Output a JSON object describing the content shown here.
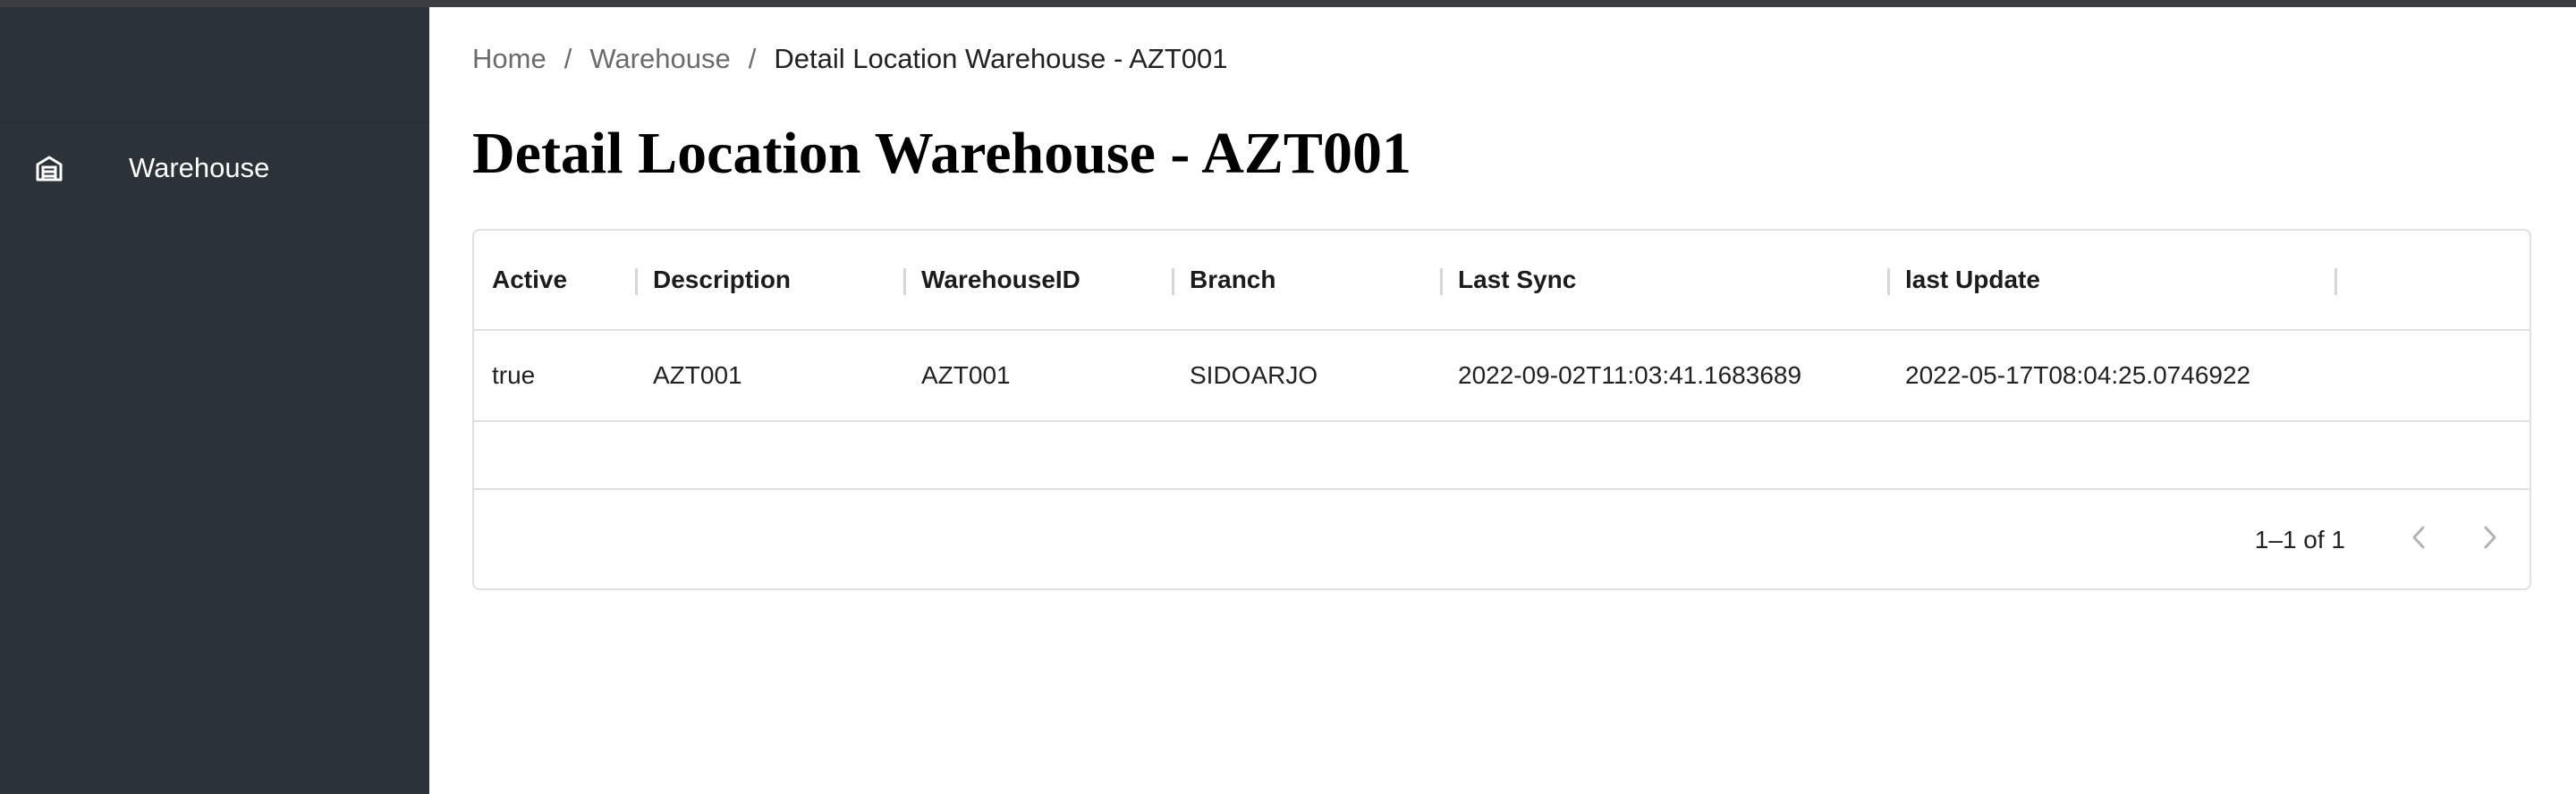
{
  "sidebar": {
    "items": [
      {
        "label": "Warehouse",
        "icon": "warehouse-icon"
      }
    ]
  },
  "breadcrumb": {
    "home": "Home",
    "warehouse": "Warehouse",
    "current": "Detail Location Warehouse - AZT001",
    "separator": "/"
  },
  "page": {
    "title": "Detail Location Warehouse - AZT001"
  },
  "table": {
    "columns": [
      "Active",
      "Description",
      "WarehouseID",
      "Branch",
      "Last Sync",
      "last Update"
    ],
    "rows": [
      [
        "true",
        "AZT001",
        "AZT001",
        "SIDOARJO",
        "2022-09-02T11:03:41.1683689",
        "2022-05-17T08:04:25.0746922"
      ]
    ]
  },
  "pagination": {
    "text": "1–1 of 1",
    "prev_icon": "chevron-left-icon",
    "next_icon": "chevron-right-icon"
  },
  "colors": {
    "sidebar_bg": "#2b3238",
    "topbar": "#3a3d42",
    "border": "#e0e0e0",
    "muted_text": "#6b6b6b"
  }
}
